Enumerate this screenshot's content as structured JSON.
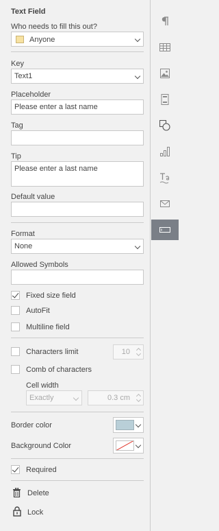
{
  "panel": {
    "title": "Text Field",
    "who_label": "Who needs to fill this out?",
    "who_value": "Anyone",
    "who_color": "#f7e2a2",
    "key_label": "Key",
    "key_value": "Text1",
    "placeholder_label": "Placeholder",
    "placeholder_value": "Please enter a last name",
    "tag_label": "Tag",
    "tag_value": "",
    "tip_label": "Tip",
    "tip_value": "Please enter a last name",
    "default_label": "Default value",
    "default_value": "",
    "format_label": "Format",
    "format_value": "None",
    "allowed_label": "Allowed Symbols",
    "allowed_value": "",
    "fixed_size_label": "Fixed size field",
    "fixed_size_checked": true,
    "autofit_label": "AutoFit",
    "autofit_checked": false,
    "multiline_label": "Multiline field",
    "multiline_checked": false,
    "char_limit_label": "Characters limit",
    "char_limit_checked": false,
    "char_limit_value": "10",
    "comb_label": "Comb of characters",
    "comb_checked": false,
    "cell_width_label": "Cell width",
    "cell_width_mode": "Exactly",
    "cell_width_value": "0.3 cm",
    "border_color_label": "Border color",
    "border_color": "#b9cfd8",
    "background_color_label": "Background Color",
    "background_color": "none",
    "required_label": "Required",
    "required_checked": true,
    "delete_label": "Delete",
    "lock_label": "Lock"
  },
  "rail": {
    "items": [
      {
        "icon": "paragraph-icon",
        "active": false
      },
      {
        "icon": "table-icon",
        "active": false
      },
      {
        "icon": "image-icon",
        "active": false
      },
      {
        "icon": "header-footer-icon",
        "active": false
      },
      {
        "icon": "shape-icon",
        "active": false
      },
      {
        "icon": "chart-icon",
        "active": false
      },
      {
        "icon": "text-art-icon",
        "active": false
      },
      {
        "icon": "mail-merge-icon",
        "active": false
      },
      {
        "icon": "form-field-icon",
        "active": true
      }
    ]
  }
}
